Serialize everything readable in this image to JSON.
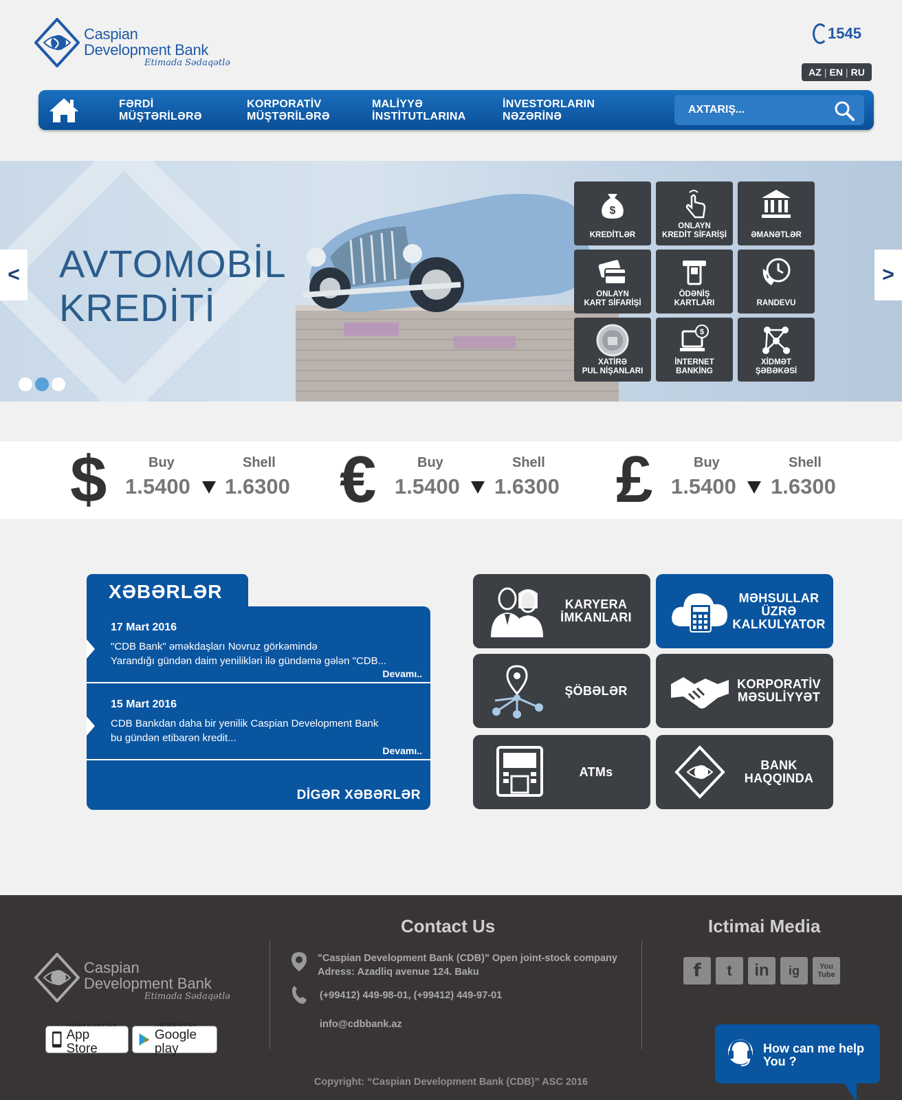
{
  "header": {
    "brand_line1": "Caspian",
    "brand_line2": "Development Bank",
    "slogan": "Etimada Sədaqətlə",
    "hotline": "1545",
    "languages": [
      "AZ",
      "EN",
      "RU"
    ]
  },
  "nav": {
    "items": [
      {
        "line1": "FƏRDİ",
        "line2": "MÜŞTƏRİLƏRƏ"
      },
      {
        "line1": "KORPORATİV",
        "line2": "MÜŞTƏRİLƏRƏ"
      },
      {
        "line1": "MALİYYƏ",
        "line2": "İNSTİTUTLARINA"
      },
      {
        "line1": "İNVESTORLARIN",
        "line2": "NƏZƏRİNƏ"
      }
    ],
    "search_placeholder": "AXTARIŞ..."
  },
  "banner": {
    "headline_line1": "AVTOMOBİL",
    "headline_line2": "KREDİTİ",
    "prev": "<",
    "next": ">",
    "slides": 3,
    "active_slide": 2,
    "tiles": [
      {
        "label": "KREDİTLƏR",
        "icon": "money-bag-icon"
      },
      {
        "label": "ONLAYN\nKREDİT SİFARİŞİ",
        "icon": "touch-hand-icon"
      },
      {
        "label": "ƏMANƏTLƏR",
        "icon": "bank-building-icon"
      },
      {
        "label": "ONLAYN\nKART SİFARİŞİ",
        "icon": "card-hand-icon"
      },
      {
        "label": "ÖDƏNİŞ\nKARTLARI",
        "icon": "card-slot-icon"
      },
      {
        "label": "RANDEVU",
        "icon": "phone-clock-icon"
      },
      {
        "label": "XATİRƏ\nPUL NİŞANLARI",
        "icon": "coin-icon"
      },
      {
        "label": "İNTERNET\nBANKİNG",
        "icon": "laptop-dollar-icon"
      },
      {
        "label": "XİDMƏT\nŞƏBƏKƏSİ",
        "icon": "network-icon"
      }
    ]
  },
  "rates": [
    {
      "currency": "$",
      "buy_label": "Buy",
      "sell_label": "Shell",
      "buy": "1.5400",
      "sell": "1.6300"
    },
    {
      "currency": "€",
      "buy_label": "Buy",
      "sell_label": "Shell",
      "buy": "1.5400",
      "sell": "1.6300"
    },
    {
      "currency": "£",
      "buy_label": "Buy",
      "sell_label": "Shell",
      "buy": "1.5400",
      "sell": "1.6300"
    }
  ],
  "news": {
    "title": "XƏBƏRLƏR",
    "items": [
      {
        "date": "17 Mart 2016",
        "line1": "\"CDB Bank\" əməkdaşları Novruz görkəmində",
        "line2": "Yarandığı gündən daim yenilikləri ilə gündəmə gələn \"CDB...",
        "more": "Devamı.."
      },
      {
        "date": "15 Mart 2016",
        "line1": "CDB Bankdan daha bir yenilik Caspian Development Bank",
        "line2": "bu gündən etibarən kredit...",
        "more": "Devamı.."
      }
    ],
    "all_label": "DİGƏR XƏBƏRLƏR"
  },
  "services": [
    {
      "label": "KARYERA\nİMKANLARI",
      "icon": "people-icon",
      "style": "dark"
    },
    {
      "label": "MƏHSULLAR\nÜZRƏ\nKALKULYATOR",
      "icon": "cloud-calculator-icon",
      "style": "blue"
    },
    {
      "label": "ŞÖBƏLƏR",
      "icon": "location-network-icon",
      "style": "dark"
    },
    {
      "label": "KORPORATİV\nMƏSULİYYƏT",
      "icon": "handshake-icon",
      "style": "dark"
    },
    {
      "label": "ATMs",
      "icon": "atm-icon",
      "style": "dark"
    },
    {
      "label": "BANK\nHAQQINDA",
      "icon": "bank-logo-icon",
      "style": "dark"
    }
  ],
  "footer": {
    "contact_title": "Contact Us",
    "company": "\"Caspian Development Bank (CDB)\" Open joint-stock company",
    "address": "Adress: Azadliq avenue 124. Baku",
    "phones": "(+99412) 449-98-01, (+99412) 449-97-01",
    "email": "info@cdbbank.az",
    "social_title": "Ictimai Media",
    "social": [
      "f",
      "t",
      "in",
      "ig",
      "You Tube"
    ],
    "appstore_small": "Available on the iPhone",
    "appstore_big": "App Store",
    "gplay_small": "ANDROID APP ON",
    "gplay_big": "Google play",
    "copyright": "Copyright: “Caspian Development Bank (CDB)” ASC 2016"
  },
  "chat": {
    "label": "How can me help\nYou ?"
  },
  "colors": {
    "primary": "#0a55a0",
    "dark_tile": "#3c3f44",
    "footer": "#393535"
  }
}
